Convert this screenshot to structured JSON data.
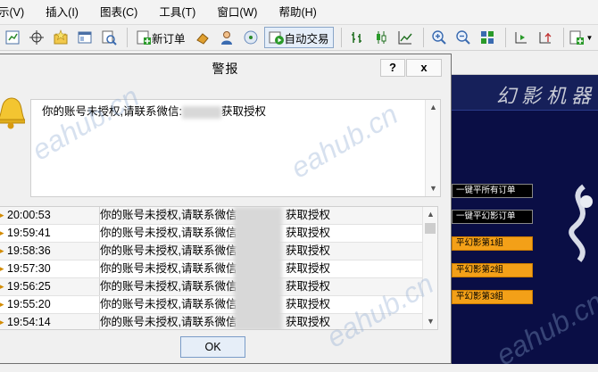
{
  "menu": [
    "示(V)",
    "插入(I)",
    "图表(C)",
    "工具(T)",
    "窗口(W)",
    "帮助(H)"
  ],
  "toolbar": {
    "new_order_label": "新订单",
    "auto_trade_label": "自动交易"
  },
  "dialog": {
    "title": "警报",
    "help_label": "?",
    "close_label": "x",
    "message": "你的账号未授权,请联系微信:",
    "message_suffix": "获取授权",
    "ok_label": "OK"
  },
  "log": {
    "rows": [
      {
        "time": "20:00:53",
        "msg": "你的账号未授权,请联系微信:",
        "suffix": "获取授权"
      },
      {
        "time": "19:59:41",
        "msg": "你的账号未授权,请联系微信:",
        "suffix": "获取授权"
      },
      {
        "time": "19:58:36",
        "msg": "你的账号未授权,请联系微信:",
        "suffix": "获取授权"
      },
      {
        "time": "19:57:30",
        "msg": "你的账号未授权,请联系微信:",
        "suffix": "获取授权"
      },
      {
        "time": "19:56:25",
        "msg": "你的账号未授权,请联系微信:",
        "suffix": "获取授权"
      },
      {
        "time": "19:55:20",
        "msg": "你的账号未授权,请联系微信:",
        "suffix": "获取授权"
      },
      {
        "time": "19:54:14",
        "msg": "你的账号未授权,请联系微信:",
        "suffix": "获取授权"
      }
    ]
  },
  "chart": {
    "banner": "幻影机器",
    "buttons": [
      "一键平所有订单",
      "一键平幻影订单",
      "平幻影第1組",
      "平幻影第2組",
      "平幻影第3組"
    ]
  },
  "watermark": "eahub.cn"
}
